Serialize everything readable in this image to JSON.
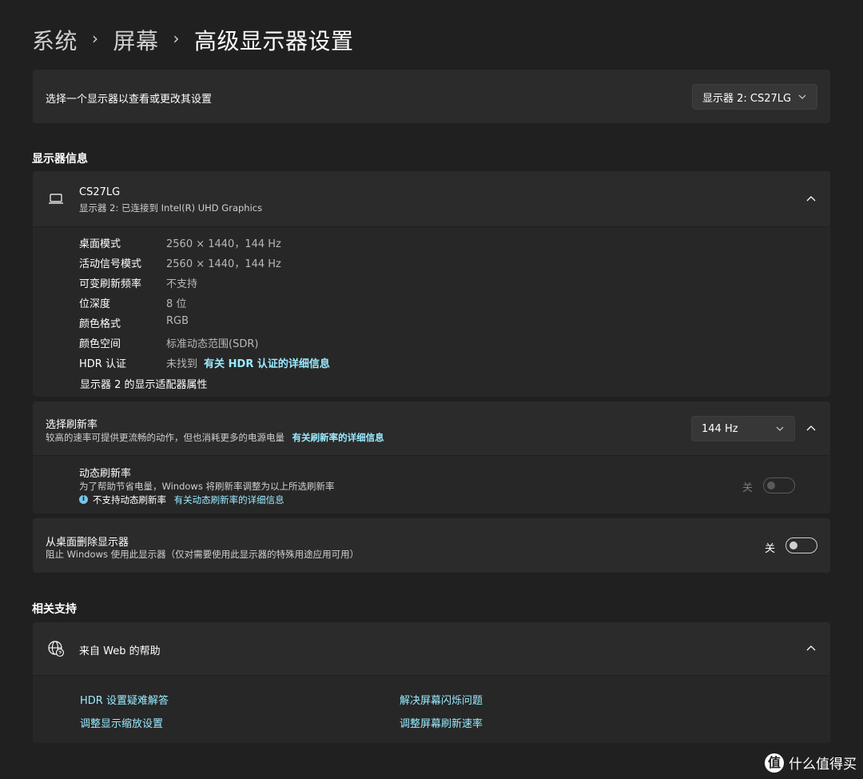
{
  "breadcrumb": {
    "items": [
      "系统",
      "屏幕"
    ],
    "current": "高级显示器设置",
    "separator": "›"
  },
  "select_display": {
    "label": "选择一个显示器以查看或更改其设置",
    "value": "显示器 2: CS27LG"
  },
  "display_info": {
    "section_title": "显示器信息",
    "name": "CS27LG",
    "subtitle": "显示器 2: 已连接到 Intel(R) UHD Graphics",
    "rows": [
      {
        "label": "桌面模式",
        "value": "2560 × 1440，144 Hz"
      },
      {
        "label": "活动信号模式",
        "value": "2560 × 1440，144 Hz"
      },
      {
        "label": "可变刷新频率",
        "value": "不支持"
      },
      {
        "label": "位深度",
        "value": "8 位"
      },
      {
        "label": "颜色格式",
        "value": "RGB"
      },
      {
        "label": "颜色空间",
        "value": "标准动态范围(SDR)"
      }
    ],
    "hdr": {
      "label": "HDR 认证",
      "value": "未找到",
      "link": "有关 HDR 认证的详细信息"
    },
    "adapter_link": "显示器 2 的显示适配器属性"
  },
  "refresh": {
    "title": "选择刷新率",
    "desc": "较高的速率可提供更流畅的动作，但也消耗更多的电源电量",
    "link": "有关刷新率的详细信息",
    "value": "144 Hz",
    "dynamic": {
      "title": "动态刷新率",
      "desc": "为了帮助节省电量，Windows 将刷新率调整为以上所选刷新率",
      "info_icon": "i",
      "unsupported": "不支持动态刷新率",
      "link": "有关动态刷新率的详细信息",
      "toggle_label": "关",
      "toggle_on": false
    }
  },
  "remove_display": {
    "title": "从桌面删除显示器",
    "desc": "阻止 Windows 使用此显示器（仅对需要使用此显示器的特殊用途应用可用）",
    "toggle_label": "关",
    "toggle_on": false
  },
  "support": {
    "section_title": "相关支持",
    "help_title": "来自 Web 的帮助",
    "links": [
      "HDR 设置疑难解答",
      "解决屏幕闪烁问题",
      "调整显示缩放设置",
      "调整屏幕刷新速率"
    ]
  },
  "watermark": {
    "logo": "值",
    "text": "什么值得买"
  },
  "colors": {
    "background": "#202020",
    "card": "#2b2b2b",
    "link": "#99ebff",
    "text": "#ffffff"
  }
}
